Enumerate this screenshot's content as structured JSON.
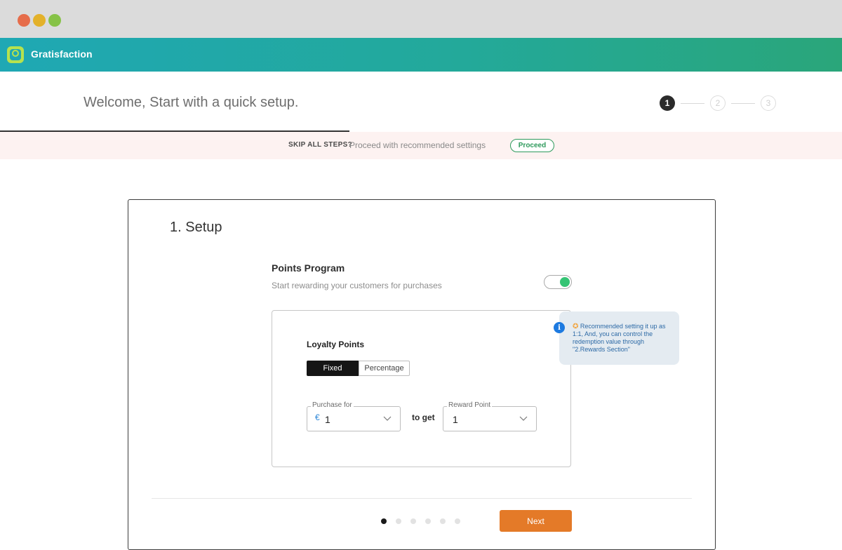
{
  "window": {
    "controls": [
      "close",
      "minimize",
      "maximize"
    ]
  },
  "brand": {
    "name": "Gratisfaction",
    "logo_icon": "ribbon-award-icon",
    "colors": {
      "gradient_start": "#1fa8b4",
      "gradient_end": "#2aa67a",
      "logo": "#b6e24e"
    }
  },
  "header": {
    "welcome": "Welcome, Start with a quick setup.",
    "steps": [
      "1",
      "2",
      "3"
    ],
    "active_step": 1,
    "progress_fraction": 0.415
  },
  "skip": {
    "label": "SKIP ALL STEPS?",
    "text": "Proceed with recommended settings",
    "proceed_label": "Proceed"
  },
  "setup": {
    "title": "1. Setup",
    "program_title": "Points Program",
    "program_subtitle": "Start rewarding your customers for purchases",
    "program_enabled": true,
    "loyalty": {
      "title": "Loyalty Points",
      "modes": [
        "Fixed",
        "Percentage"
      ],
      "selected_mode": "Fixed",
      "purchase_label": "Purchase for",
      "currency_symbol": "€",
      "purchase_value": "1",
      "to_get": "to get",
      "reward_label": "Reward Point",
      "reward_value": "1"
    },
    "tooltip": {
      "icon": "info-icon",
      "star": "✪",
      "text": "Recommended setting it up as 1:1, And, you can control the redemption value through \"2.Rewards Section\""
    }
  },
  "pagination": {
    "total": 6,
    "current": 1
  },
  "next_label": "Next",
  "colors": {
    "accent": "#e47a28",
    "toggle_on": "#35c474",
    "proceed": "#2e9a5c",
    "info": "#1d7ae0"
  }
}
